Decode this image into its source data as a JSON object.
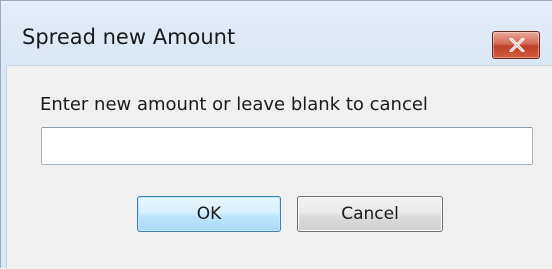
{
  "window": {
    "title": "Spread new Amount",
    "close_icon": "close-icon"
  },
  "form": {
    "prompt": "Enter new amount or leave blank to cancel",
    "amount_value": "",
    "amount_placeholder": ""
  },
  "buttons": {
    "ok_label": "OK",
    "cancel_label": "Cancel"
  },
  "colors": {
    "frame": "#dce7f4",
    "client": "#f0f0f0",
    "close_button": "#c1402a",
    "ok_border": "#3c7fb1"
  }
}
